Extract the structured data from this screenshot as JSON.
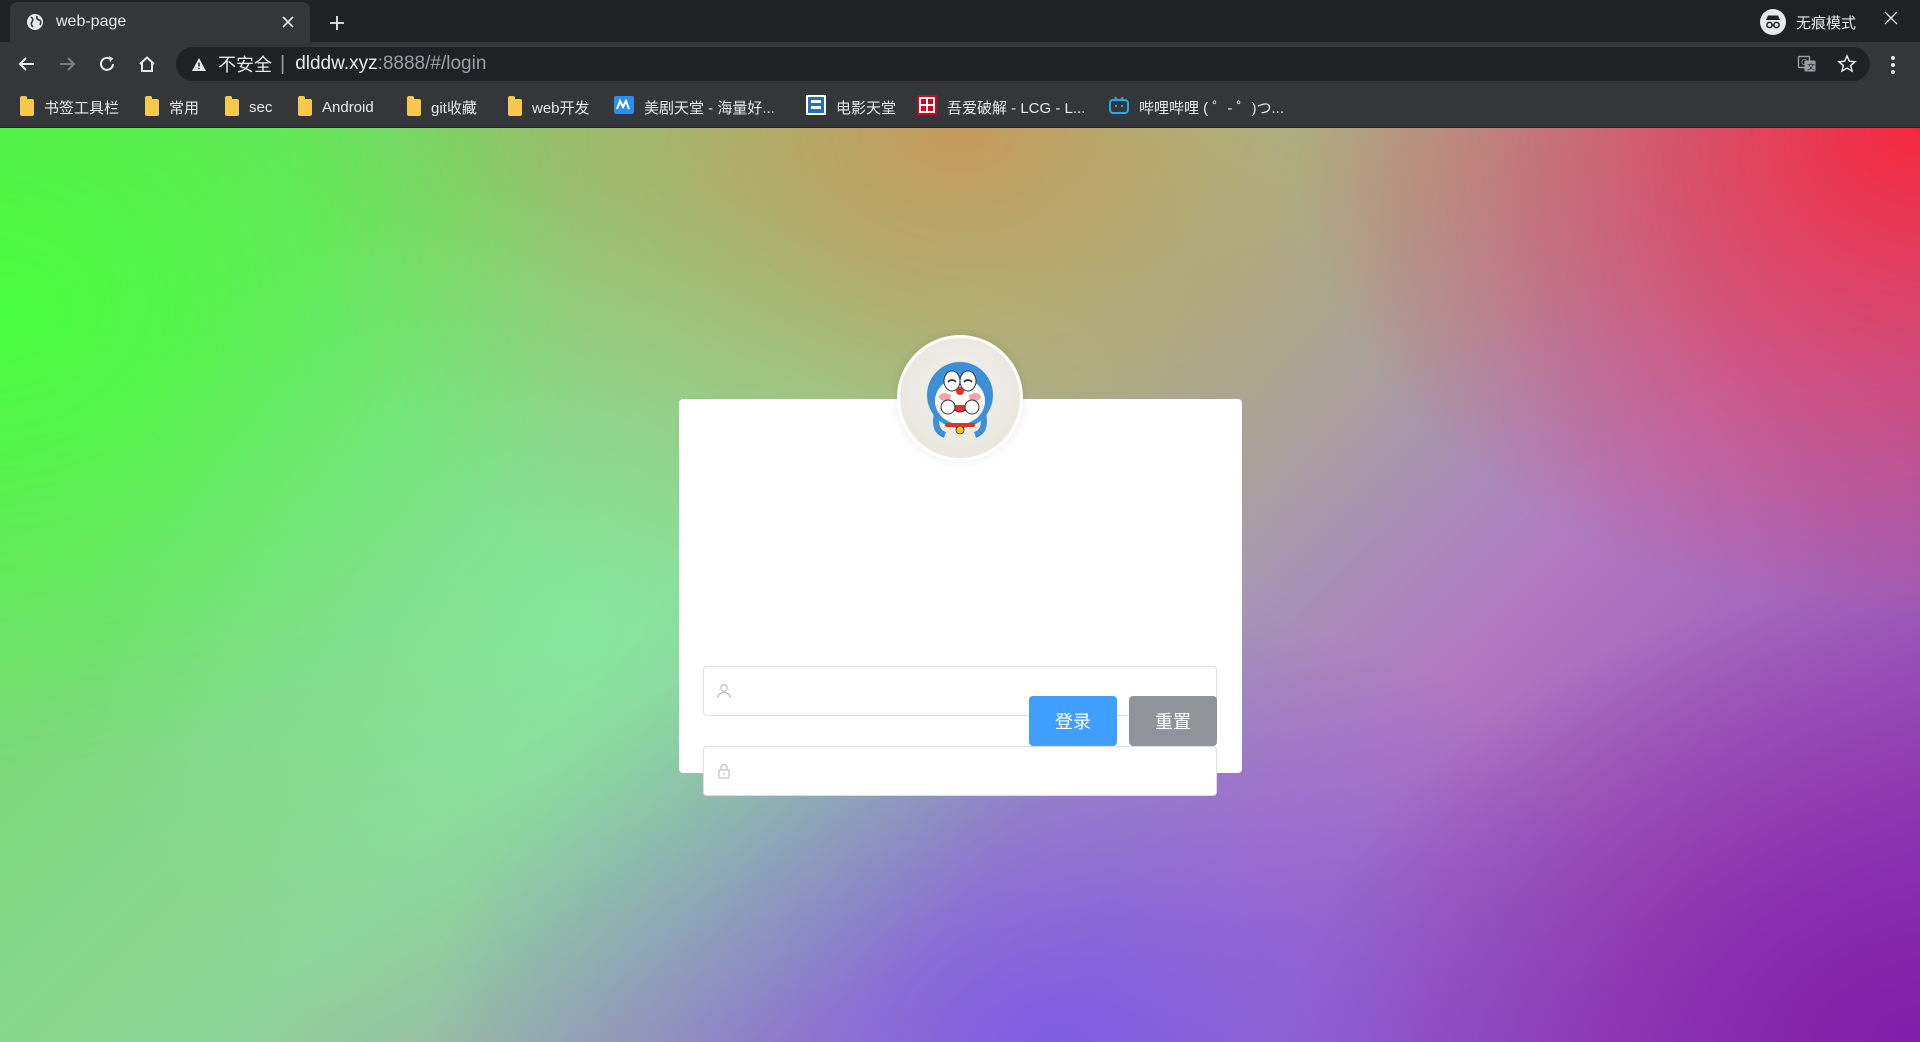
{
  "browser": {
    "tab_title": "web-page",
    "address": {
      "security_label": "不安全",
      "host": "dlddw.xyz",
      "path": ":8888/#/login"
    },
    "incognito_label": "无痕模式"
  },
  "bookmarks": [
    {
      "label": "书签工具栏",
      "icon": "folder-icon"
    },
    {
      "label": "常用",
      "icon": "folder-icon"
    },
    {
      "label": "sec",
      "icon": "folder-icon"
    },
    {
      "label": "Android",
      "icon": "folder-icon"
    },
    {
      "label": "git收藏",
      "icon": "folder-icon"
    },
    {
      "label": "web开发",
      "icon": "folder-icon"
    },
    {
      "label": "美剧天堂 - 海量好...",
      "icon": "site-icon"
    },
    {
      "label": "电影天堂",
      "icon": "site-icon"
    },
    {
      "label": "吾爱破解 - LCG - L...",
      "icon": "site-icon"
    },
    {
      "label": "哔哩哔哩 ( ゜- ゜)つ...",
      "icon": "bilibili-icon"
    }
  ],
  "login": {
    "username_value": "",
    "password_value": "",
    "login_button": "登录",
    "reset_button": "重置"
  },
  "colors": {
    "primary": "#409eff",
    "info": "#909399",
    "chrome_dark": "#202124",
    "chrome_toolbar": "#35363a"
  }
}
